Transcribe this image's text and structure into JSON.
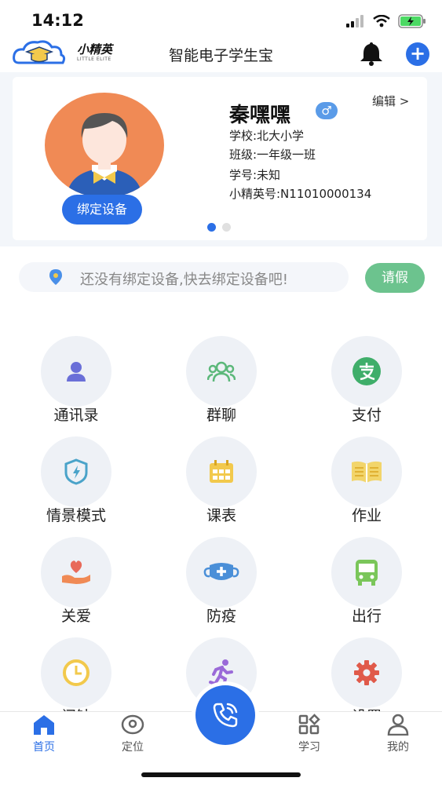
{
  "status": {
    "time": "14:12"
  },
  "header": {
    "logo_text": "小精英",
    "logo_sub": "LITTLE ELITE",
    "title": "智能电子学生宝"
  },
  "profile": {
    "name": "秦嘿嘿",
    "gender_symbol": "♂",
    "edit_label": "编辑 >",
    "school": "学校:北大小学",
    "class": "班级:一年级一班",
    "student_id": "学号:未知",
    "elite_id": "小精英号:N11010000134",
    "bind_label": "绑定设备"
  },
  "notice": {
    "text": "还没有绑定设备,快去绑定设备吧!",
    "leave_label": "请假"
  },
  "grid": [
    {
      "label": "通讯录",
      "icon": "contacts-icon",
      "color": "#6a6fd8"
    },
    {
      "label": "群聊",
      "icon": "group-chat-icon",
      "color": "#5cb87a"
    },
    {
      "label": "支付",
      "icon": "alipay-icon",
      "color": "#3fae6a"
    },
    {
      "label": "情景模式",
      "icon": "scene-mode-icon",
      "color": "#4aa3c9"
    },
    {
      "label": "课表",
      "icon": "timetable-icon",
      "color": "#f2c94c"
    },
    {
      "label": "作业",
      "icon": "homework-icon",
      "color": "#f2d56b"
    },
    {
      "label": "关爱",
      "icon": "care-icon",
      "color": "#e86a5a"
    },
    {
      "label": "防疫",
      "icon": "mask-icon",
      "color": "#4a8fd8"
    },
    {
      "label": "出行",
      "icon": "bus-icon",
      "color": "#7ac65a"
    },
    {
      "label": "闹钟",
      "icon": "clock-icon",
      "color": "#f2c94c"
    },
    {
      "label": "运动",
      "icon": "run-icon",
      "color": "#9a6ad8"
    },
    {
      "label": "设置",
      "icon": "settings-icon",
      "color": "#e05a4a"
    }
  ],
  "tabs": [
    {
      "label": "首页",
      "icon": "home-icon",
      "active": true
    },
    {
      "label": "定位",
      "icon": "location-icon"
    },
    {
      "label": "学习",
      "icon": "study-icon"
    },
    {
      "label": "我的",
      "icon": "profile-icon"
    }
  ]
}
